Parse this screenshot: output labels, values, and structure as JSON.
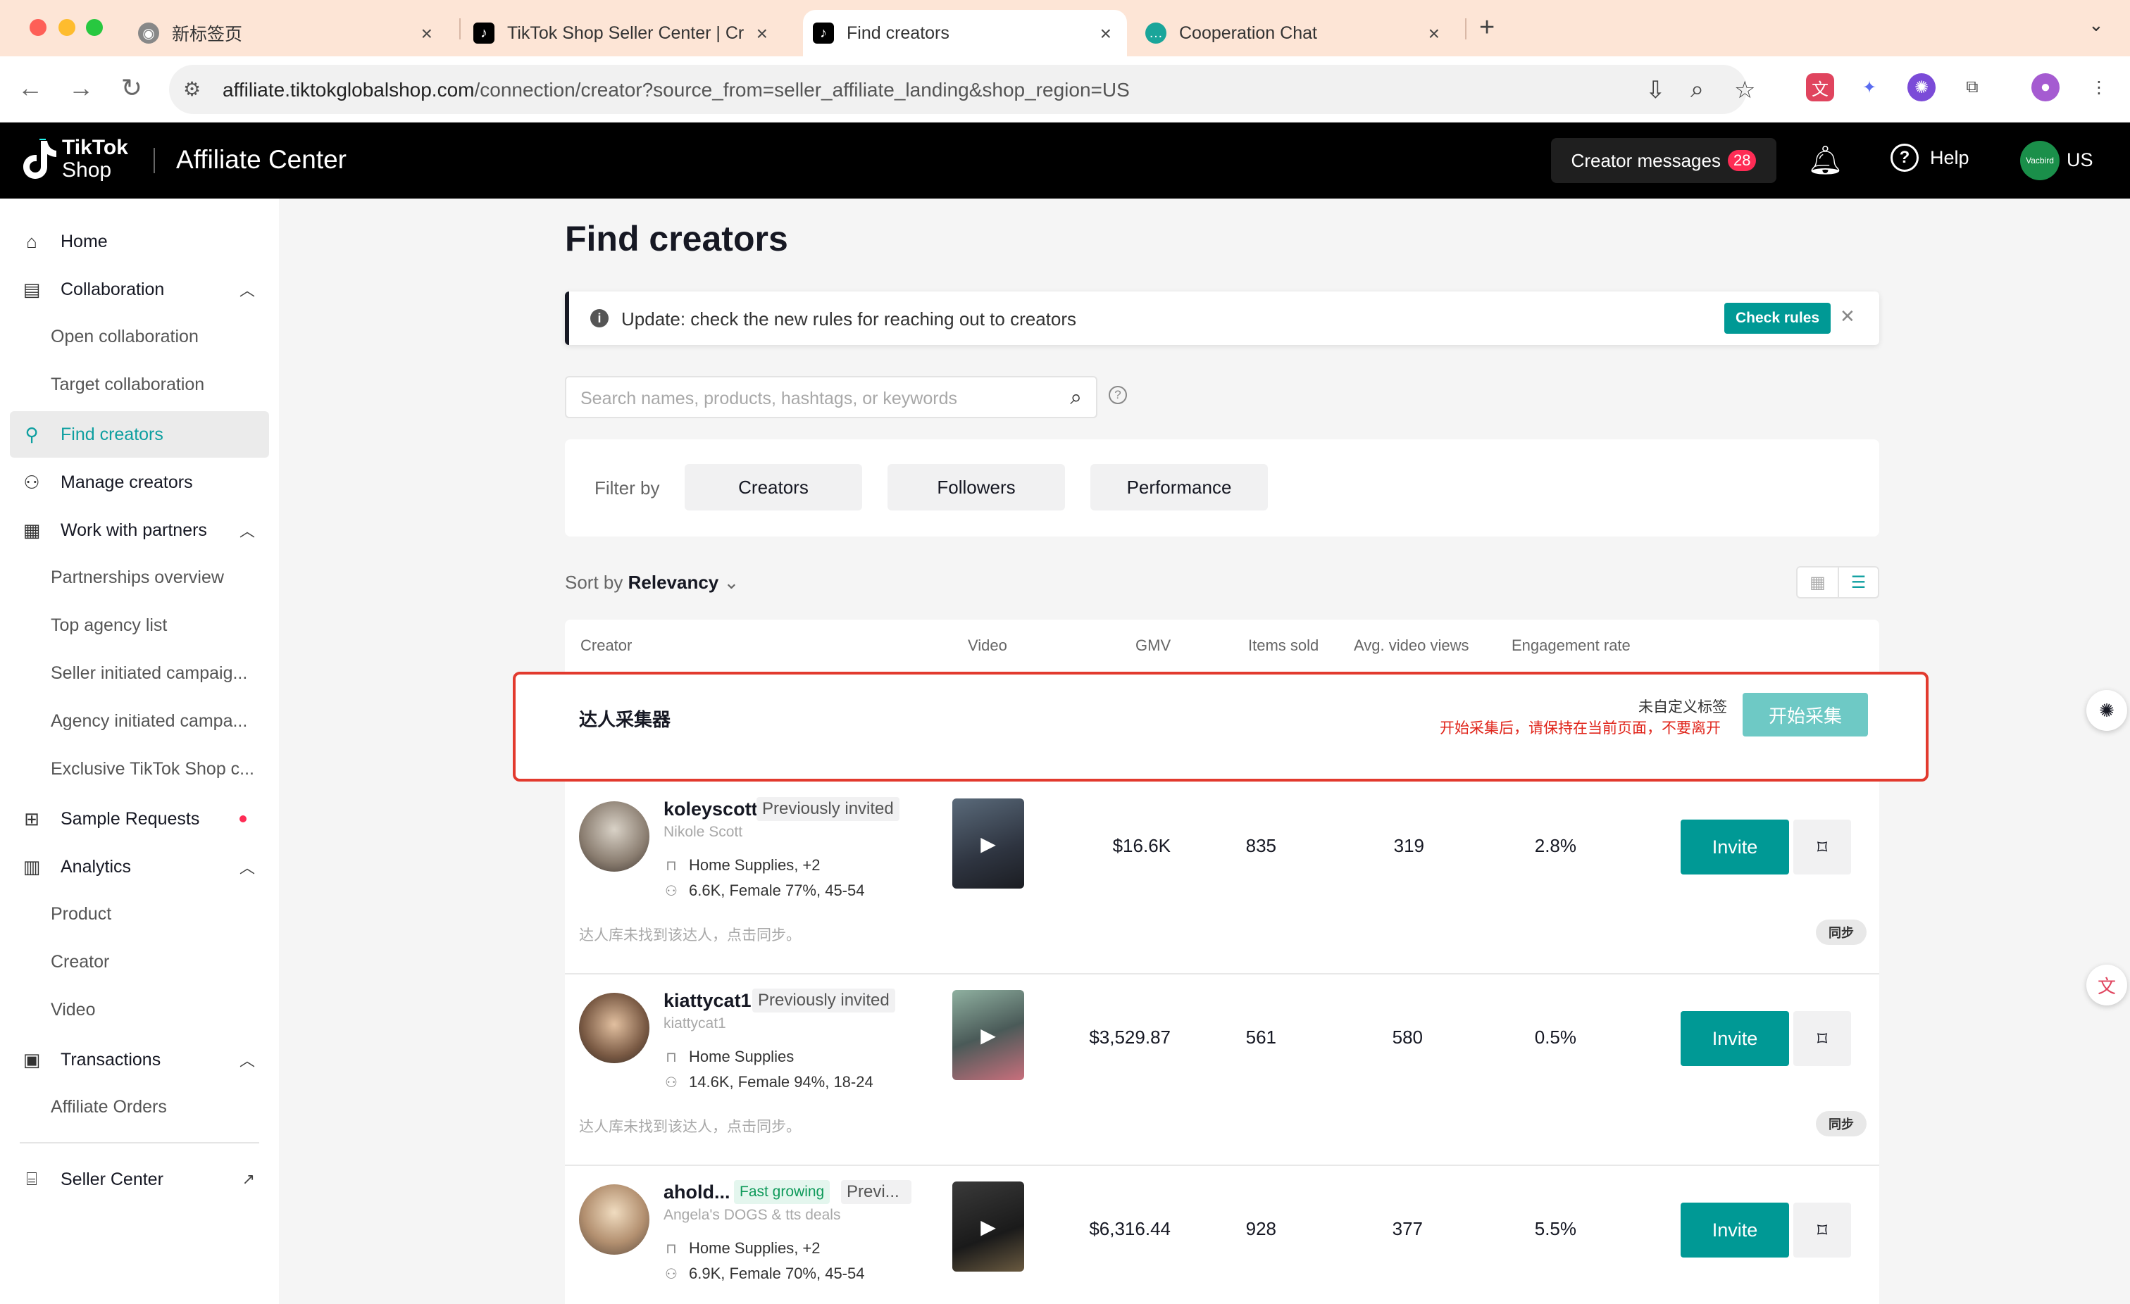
{
  "browser": {
    "tabs": [
      {
        "title": "新标签页",
        "active": false
      },
      {
        "title": "TikTok Shop Seller Center | Cr",
        "active": false
      },
      {
        "title": "Find creators",
        "active": true
      },
      {
        "title": "Cooperation Chat",
        "active": false
      }
    ],
    "url_host": "affiliate.tiktokglobalshop.com",
    "url_path": "/connection/creator?source_from=seller_affiliate_landing&shop_region=US"
  },
  "header": {
    "logo_line1": "TikTok",
    "logo_line2": "Shop",
    "app_title": "Affiliate Center",
    "creator_messages_label": "Creator messages",
    "creator_messages_count": "28",
    "help_label": "Help",
    "shop_avatar_text": "Vacbird",
    "region": "US"
  },
  "sidebar": {
    "home": "Home",
    "collaboration": "Collaboration",
    "open_collaboration": "Open collaboration",
    "target_collaboration": "Target collaboration",
    "find_creators": "Find creators",
    "manage_creators": "Manage creators",
    "work_with_partners": "Work with partners",
    "partnerships_overview": "Partnerships overview",
    "top_agency_list": "Top agency list",
    "seller_initiated": "Seller initiated campaig...",
    "agency_initiated": "Agency initiated campa...",
    "exclusive": "Exclusive TikTok Shop c...",
    "sample_requests": "Sample Requests",
    "analytics": "Analytics",
    "product": "Product",
    "creator": "Creator",
    "video": "Video",
    "transactions": "Transactions",
    "affiliate_orders": "Affiliate Orders",
    "seller_center": "Seller Center"
  },
  "main": {
    "title": "Find creators",
    "banner_text": "Update: check the new rules for reaching out to creators",
    "check_rules": "Check rules",
    "search_placeholder": "Search names, products, hashtags, or keywords",
    "filter_by": "Filter by",
    "filters": [
      "Creators",
      "Followers",
      "Performance"
    ],
    "sort_by_label": "Sort by",
    "sort_by_value": "Relevancy",
    "columns": [
      "Creator",
      "Video",
      "GMV",
      "Items sold",
      "Avg. video views",
      "Engagement rate"
    ]
  },
  "collector": {
    "title": "达人采集器",
    "tag_text": "未自定义标签",
    "warning": "开始采集后，请保持在当前页面，不要离开",
    "start_button": "开始采集"
  },
  "creators": [
    {
      "handle": "koleyscott",
      "tag1": "Previously invited",
      "nickname": "Nikole Scott",
      "category": "Home Supplies, +2",
      "audience": "6.6K, Female 77%, 45-54",
      "gmv": "$16.6K",
      "items_sold": "835",
      "avg_views": "319",
      "engagement": "2.8%",
      "invite": "Invite",
      "sync_note": "达人库未找到该达人，点击同步。",
      "sync_button": "同步"
    },
    {
      "handle": "kiattycat1",
      "tag1": "Previously invited",
      "nickname": "kiattycat1",
      "category": "Home Supplies",
      "audience": "14.6K, Female 94%, 18-24",
      "gmv": "$3,529.87",
      "items_sold": "561",
      "avg_views": "580",
      "engagement": "0.5%",
      "invite": "Invite",
      "sync_note": "达人库未找到该达人，点击同步。",
      "sync_button": "同步"
    },
    {
      "handle": "ahold...",
      "tag_green": "Fast growing",
      "tag1": "Previ...",
      "nickname": "Angela's DOGS & tts deals",
      "category": "Home Supplies, +2",
      "audience": "6.9K, Female 70%, 45-54",
      "gmv": "$6,316.44",
      "items_sold": "928",
      "avg_views": "377",
      "engagement": "5.5%",
      "invite": "Invite"
    }
  ],
  "colors": {
    "accent": "#009995",
    "active_nav": "#0e9fa0",
    "collector_border": "#e23a2e",
    "badge": "#fe2c55"
  }
}
